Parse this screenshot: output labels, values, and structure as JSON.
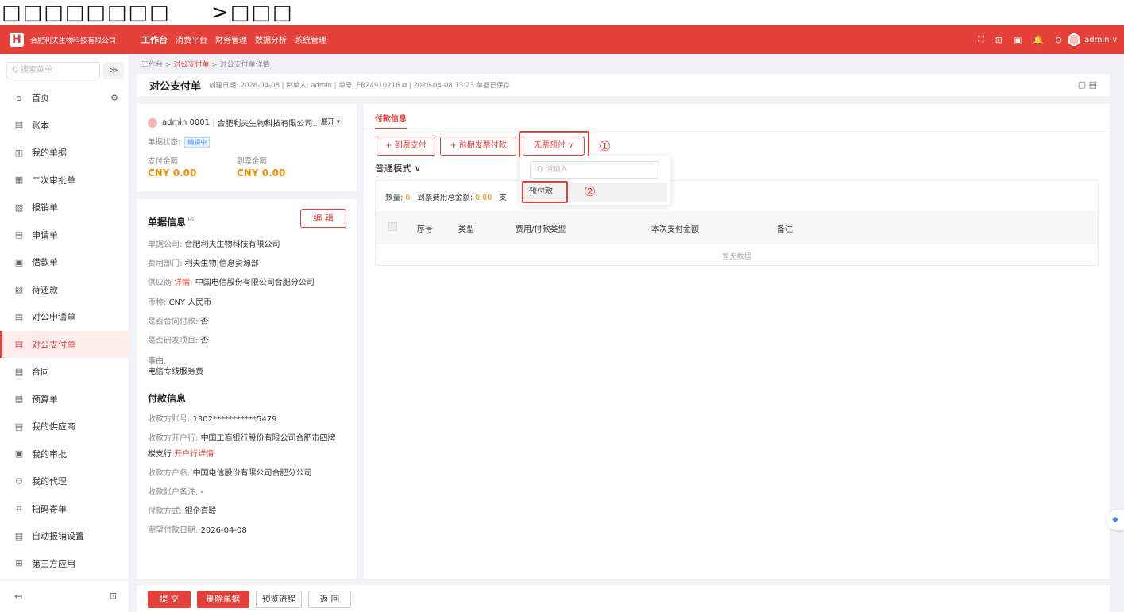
{
  "caption": {
    "left": "□□□□□□□□",
    "right": ">□□□"
  },
  "header": {
    "logo": "H",
    "company": "合肥利夫生物科技有限公司",
    "nav": [
      "工作台",
      "消费平台",
      "财务管理",
      "数据分析",
      "系统管理"
    ],
    "icons": [
      "⛶",
      "⊞",
      "▣",
      "🔔",
      "⊙",
      "⚡"
    ],
    "user": "admin ∨"
  },
  "sidebar": {
    "search_placeholder": "Q 搜索菜单",
    "collapse": "≫",
    "items": [
      {
        "icon": "⌂",
        "label": "首页"
      },
      {
        "icon": "▤",
        "label": "账本"
      },
      {
        "icon": "▥",
        "label": "我的单据"
      },
      {
        "icon": "▦",
        "label": "二次审批单"
      },
      {
        "icon": "▧",
        "label": "报销单"
      },
      {
        "icon": "▤",
        "label": "申请单"
      },
      {
        "icon": "▣",
        "label": "借款单"
      },
      {
        "icon": "▨",
        "label": "待还款"
      },
      {
        "icon": "▤",
        "label": "对公申请单"
      },
      {
        "icon": "▤",
        "label": "对公支付单"
      },
      {
        "icon": "▤",
        "label": "合同"
      },
      {
        "icon": "▤",
        "label": "预算单"
      },
      {
        "icon": "▤",
        "label": "我的供应商"
      },
      {
        "icon": "▣",
        "label": "我的审批"
      },
      {
        "icon": "⚇",
        "label": "我的代理"
      },
      {
        "icon": "⌗",
        "label": "扫码寄单"
      },
      {
        "icon": "▤",
        "label": "自动报销设置"
      },
      {
        "icon": "⊞",
        "label": "第三方应用"
      }
    ],
    "home_extra_icon": "⚙",
    "bottom_left": "↤",
    "bottom_right": "⊡"
  },
  "breadcrumb": {
    "p1": "工作台",
    "sep": ">",
    "p2": "对公支付单",
    "p3": "对公支付单详情"
  },
  "titlebar": {
    "title": "对公支付单",
    "meta": "创建日期: 2026-04-08 | 制单人: admin | 单号: ER24910216 ⧉ | 2026-04-08 13:23 单据已保存",
    "right_icons": "▢ ▤"
  },
  "summary_card": {
    "user": "admin 0001",
    "company": "合肥利夫生物科技有限公司...",
    "expand": "展开 ▾",
    "status_label": "单据状态:",
    "status_badge": "编辑中",
    "pay_label": "支付金额",
    "invoice_label": "到票金额",
    "pay_value": "CNY 0.00",
    "invoice_value": "CNY 0.00"
  },
  "info_card": {
    "title": "单据信息",
    "eye": "⊘",
    "edit": "编 辑",
    "company_label": "单据公司:",
    "company_value": "合肥利夫生物科技有限公司",
    "dept_label": "费用部门:",
    "dept_value": "利夫生物|信息资源部",
    "vendor_label": "供应商",
    "vendor_link": "详情:",
    "vendor_value": "中国电信股份有限公司合肥分公司",
    "currency_label": "币种:",
    "currency_value": "CNY 人民币",
    "contract_label": "是否合同付款:",
    "contract_value": "否",
    "rd_label": "是否研发项目:",
    "rd_value": "否",
    "reason_label": "事由:",
    "reason_value": "电信专线服务费",
    "pay_title": "付款信息",
    "acct_label": "收款方账号:",
    "acct_value": "1302***********5479",
    "bank_label": "收款方开户行:",
    "bank_value": "中国工商银行股份有限公司合肥市四牌",
    "bank_value2": "楼支行",
    "bank_link": "开户行详情",
    "payee_label": "收款方户名:",
    "payee_value": "中国电信股份有限公司合肥分公司",
    "note_label": "收款账户备注:",
    "note_value": "-",
    "method_label": "付款方式:",
    "method_value": "银企直联",
    "date_label": "期望付款日期:",
    "date_value": "2026-04-08"
  },
  "main": {
    "tab": "付款信息",
    "btn1": "+ 到票支付",
    "btn2": "+ 前期发票付款",
    "btn3": "无票预付 ∨",
    "mark1": "①",
    "mark2": "②",
    "mode": "普通模式 ∨",
    "count_label": "数量:",
    "count": "0",
    "total_label": "到票费用总金额:",
    "total": "0.00",
    "pay_trunc": "支",
    "columns": [
      "序号",
      "类型",
      "费用/付款类型",
      "本次支付金额",
      "备注"
    ],
    "empty": "暂无数据",
    "dropdown_search": "Q 请输入",
    "dropdown_item": "预付款"
  },
  "footer": {
    "submit": "提 交",
    "delete": "删除单据",
    "preview": "预览流程",
    "back": "返 回"
  },
  "float_icon": "◆"
}
